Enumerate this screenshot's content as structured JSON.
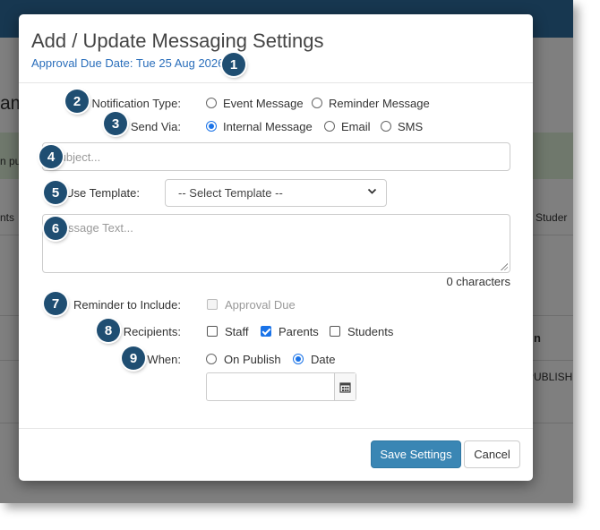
{
  "background": {
    "fragments": [
      "am",
      "n pu",
      "nts",
      "d Studer",
      "n",
      "PUBLISH"
    ]
  },
  "modal": {
    "title": "Add / Update Messaging Settings",
    "subtitle": "Approval Due Date: Tue 25 Aug 2026",
    "notification_type": {
      "label": "Notification Type:",
      "options": [
        "Event Message",
        "Reminder Message"
      ],
      "selected": null
    },
    "send_via": {
      "label": "Send Via:",
      "options": [
        "Internal Message",
        "Email",
        "SMS"
      ],
      "selected": "Internal Message"
    },
    "subject": {
      "placeholder": "Subject...",
      "value": ""
    },
    "use_template": {
      "label": "Use Template:",
      "selected": "-- Select Template --"
    },
    "message": {
      "placeholder": "Message Text...",
      "value": ""
    },
    "char_count": "0 characters",
    "reminder": {
      "label": "Reminder to Include:",
      "options": [
        "Approval Due"
      ],
      "checked": [
        false
      ],
      "disabled": true
    },
    "recipients": {
      "label": "Recipients:",
      "options": [
        "Staff",
        "Parents",
        "Students"
      ],
      "checked": [
        false,
        true,
        false
      ]
    },
    "when": {
      "label": "When:",
      "options": [
        "On Publish",
        "Date"
      ],
      "selected": "Date",
      "date_value": ""
    },
    "buttons": {
      "save": "Save Settings",
      "cancel": "Cancel"
    }
  },
  "annotations": [
    "1",
    "2",
    "3",
    "4",
    "5",
    "6",
    "7",
    "8",
    "9"
  ],
  "colors": {
    "accent": "#1a73e8",
    "primary_button": "#3a86b4",
    "subtitle": "#2a6ebb",
    "badge": "#1f4e72",
    "topbar": "#2f6fa0",
    "success_band": "#dff0d8"
  },
  "icons": [
    "calendar-icon",
    "chevron-down-icon"
  ]
}
